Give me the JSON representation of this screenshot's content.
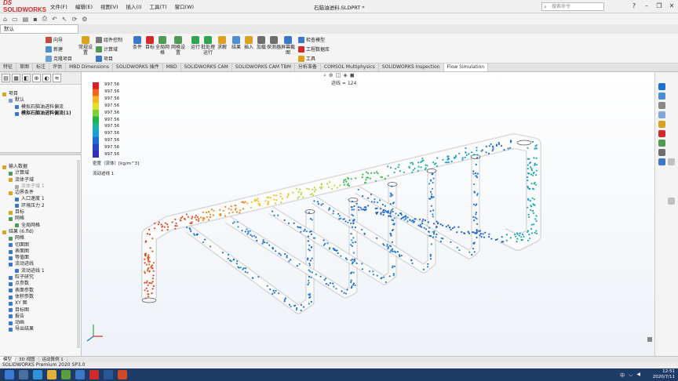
{
  "app": {
    "logo": "SOLIDWORKS",
    "doc_title": "石脑油进料.SLDPRT *",
    "menu": [
      "文件(F)",
      "编辑(E)",
      "视图(V)",
      "插入(I)",
      "工具(T)",
      "窗口(W)"
    ],
    "search_placeholder": "搜索命令",
    "window_buttons": [
      "?",
      "–",
      "❐",
      "✕"
    ]
  },
  "config": {
    "selected": "默认"
  },
  "ribbon": {
    "items": [
      "向导",
      "新建",
      "克隆项目",
      "常规设置",
      "计算域",
      "流体子域",
      "项目",
      "组件控制",
      "目标",
      "条件",
      "全局网格",
      "网格设置",
      "运行",
      "批处理运行",
      "求解",
      "结果",
      "插入",
      "加载",
      "探测器",
      "屏幕截图",
      "检查模型",
      "工程数据库",
      "工具"
    ]
  },
  "tabs": {
    "items": [
      "特征",
      "草图",
      "标注",
      "评估",
      "MBD Dimensions",
      "SOLIDWORKS 插件",
      "MBD",
      "SOLIDWORKS CAM",
      "SOLIDWORKS CAM TBM",
      "分析准备",
      "COMSOL Multiphysics",
      "SOLIDWORKS Inspection",
      "Flow Simulation"
    ],
    "active": "Flow Simulation"
  },
  "tree_top": {
    "items": [
      {
        "label": "项目",
        "style": "",
        "indent": 0,
        "color": "#d8a520"
      },
      {
        "label": "默认",
        "style": "",
        "indent": 1,
        "color": "#7a9bd1"
      },
      {
        "label": "模拟石脑油进料偏流",
        "style": "",
        "indent": 2,
        "color": "#3b78c7"
      },
      {
        "label": "模拟石脑油进料偏流(1)",
        "style": "bold",
        "indent": 2,
        "color": "#3b78c7"
      }
    ]
  },
  "tree_bottom": {
    "items": [
      {
        "label": "输入数据",
        "style": "",
        "indent": 0,
        "color": "#d8a520"
      },
      {
        "label": "计算域",
        "style": "",
        "indent": 1,
        "color": "#4f9a54"
      },
      {
        "label": "流体子域",
        "style": "",
        "indent": 1,
        "color": "#d8a520"
      },
      {
        "label": "流体子域 1",
        "style": "grey",
        "indent": 2,
        "color": "#aaaaaa"
      },
      {
        "label": "边界条件",
        "style": "",
        "indent": 1,
        "color": "#d8a520"
      },
      {
        "label": "入口速度 1",
        "style": "",
        "indent": 2,
        "color": "#3b78c7"
      },
      {
        "label": "环境压力 2",
        "style": "",
        "indent": 2,
        "color": "#3b78c7"
      },
      {
        "label": "目标",
        "style": "",
        "indent": 1,
        "color": "#d8a520"
      },
      {
        "label": "网格",
        "style": "",
        "indent": 1,
        "color": "#4f9a54"
      },
      {
        "label": "全局网格",
        "style": "",
        "indent": 2,
        "color": "#4f9a54"
      },
      {
        "label": "结果 (6.fld)",
        "style": "",
        "indent": 0,
        "color": "#d8a520"
      },
      {
        "label": "网格",
        "style": "",
        "indent": 1,
        "color": "#4f9a54"
      },
      {
        "label": "切面图",
        "style": "",
        "indent": 1,
        "color": "#3b78c7"
      },
      {
        "label": "表面图",
        "style": "",
        "indent": 1,
        "color": "#3b78c7"
      },
      {
        "label": "等值面",
        "style": "",
        "indent": 1,
        "color": "#3b78c7"
      },
      {
        "label": "流动迹线",
        "style": "",
        "indent": 1,
        "color": "#3b78c7"
      },
      {
        "label": "流动迹线 1",
        "style": "",
        "indent": 2,
        "color": "#3b78c7"
      },
      {
        "label": "粒子研究",
        "style": "",
        "indent": 1,
        "color": "#3b78c7"
      },
      {
        "label": "点参数",
        "style": "",
        "indent": 1,
        "color": "#3b78c7"
      },
      {
        "label": "表面参数",
        "style": "",
        "indent": 1,
        "color": "#3b78c7"
      },
      {
        "label": "体积参数",
        "style": "",
        "indent": 1,
        "color": "#3b78c7"
      },
      {
        "label": "XY 图",
        "style": "",
        "indent": 1,
        "color": "#3b78c7"
      },
      {
        "label": "目标图",
        "style": "",
        "indent": 1,
        "color": "#3b78c7"
      },
      {
        "label": "报告",
        "style": "",
        "indent": 1,
        "color": "#3b78c7"
      },
      {
        "label": "动画",
        "style": "",
        "indent": 1,
        "color": "#3b78c7"
      },
      {
        "label": "导出结果",
        "style": "",
        "indent": 1,
        "color": "#3b78c7"
      }
    ]
  },
  "legend": {
    "values": [
      "997.56",
      "997.56",
      "997.56",
      "997.56",
      "997.56",
      "997.56",
      "997.56",
      "997.56",
      "997.56",
      "997.56",
      "997.56"
    ],
    "title": "密度（流体）[kg/m^3]",
    "subtitle": "流动迹线 1",
    "colors": [
      "#d8212b",
      "#ef6a1f",
      "#f7b526",
      "#dfe12a",
      "#7fd13a",
      "#22b14c",
      "#19b6a6",
      "#1aa0d8",
      "#1f6fd1",
      "#2546c4",
      "#3030b0"
    ]
  },
  "viewport": {
    "note": "迹线 = 124"
  },
  "bottom_tabs": {
    "items": [
      "模型",
      "3D 视图",
      "运动算例 1"
    ],
    "active": "模型"
  },
  "status": {
    "text": "SOLIDWORKS Premium 2020 SP3.0"
  },
  "clock": {
    "time": "12:51",
    "date": "2020/7/11"
  },
  "tray": {
    "lang": "中"
  },
  "colors": {
    "accent": "#1f6fd1",
    "taskbar": "#1e3a66"
  }
}
